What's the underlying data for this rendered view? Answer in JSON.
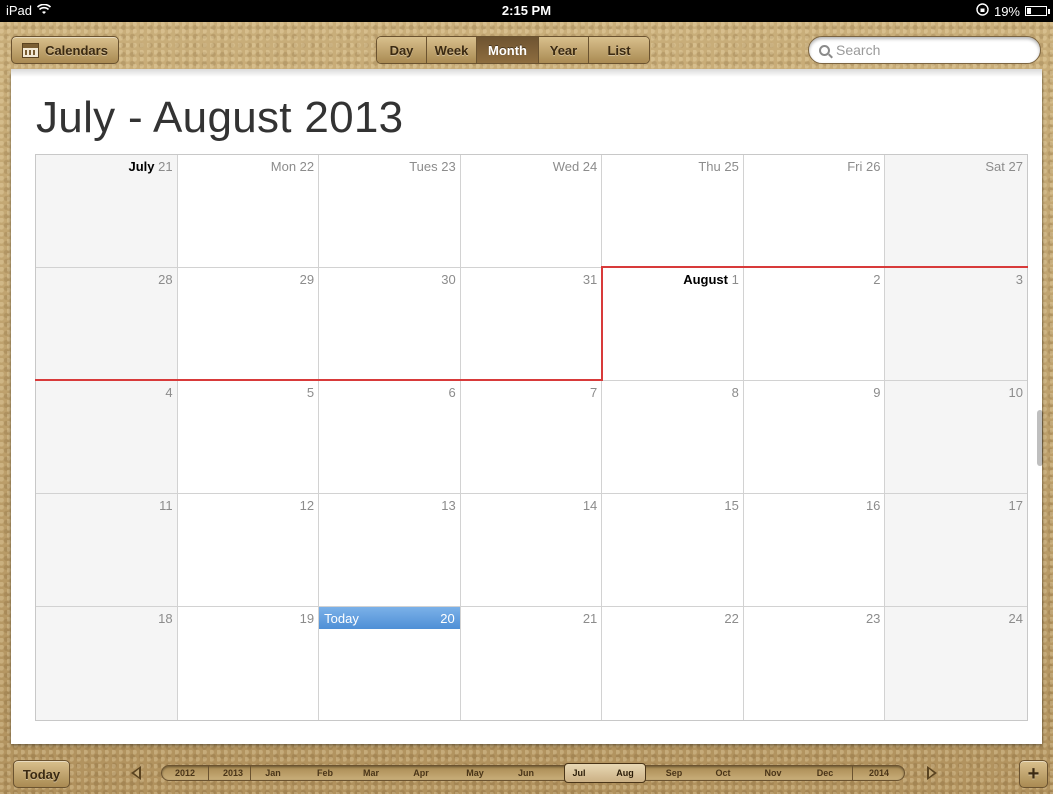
{
  "statusbar": {
    "device": "iPad",
    "time": "2:15 PM",
    "battery": "19%"
  },
  "toolbar": {
    "calendars_label": "Calendars",
    "views": [
      {
        "label": "Day",
        "active": false
      },
      {
        "label": "Week",
        "active": false
      },
      {
        "label": "Month",
        "active": true
      },
      {
        "label": "Year",
        "active": false
      },
      {
        "label": "List",
        "active": false
      }
    ],
    "search_placeholder": "Search"
  },
  "main": {
    "title": "July - August 2013",
    "weeks": [
      [
        {
          "bold": "July",
          "label": " 21"
        },
        {
          "label": "Mon 22"
        },
        {
          "label": "Tues 23"
        },
        {
          "label": "Wed 24"
        },
        {
          "label": "Thu 25"
        },
        {
          "label": "Fri 26"
        },
        {
          "label": "Sat 27"
        }
      ],
      [
        {
          "label": "28"
        },
        {
          "label": "29"
        },
        {
          "label": "30"
        },
        {
          "label": "31"
        },
        {
          "bold": "August",
          "label": " 1"
        },
        {
          "label": "2"
        },
        {
          "label": "3"
        }
      ],
      [
        {
          "label": "4"
        },
        {
          "label": "5"
        },
        {
          "label": "6"
        },
        {
          "label": "7"
        },
        {
          "label": "8"
        },
        {
          "label": "9"
        },
        {
          "label": "10"
        }
      ],
      [
        {
          "label": "11"
        },
        {
          "label": "12"
        },
        {
          "label": "13"
        },
        {
          "label": "14"
        },
        {
          "label": "15"
        },
        {
          "label": "16"
        },
        {
          "label": "17"
        }
      ],
      [
        {
          "label": "18"
        },
        {
          "label": "19"
        },
        {
          "today": true,
          "label": "Today",
          "day": "20"
        },
        {
          "label": "21"
        },
        {
          "label": "22"
        },
        {
          "label": "23"
        },
        {
          "label": "24"
        }
      ]
    ]
  },
  "bottom": {
    "today_label": "Today",
    "add_label": "+",
    "timeline": [
      "2012",
      "2013",
      "Jan",
      "Feb",
      "Mar",
      "Apr",
      "May",
      "Jun",
      "Jul",
      "Aug",
      "Sep",
      "Oct",
      "Nov",
      "Dec",
      "2014"
    ],
    "selected": [
      "Jul",
      "Aug"
    ]
  },
  "colors": {
    "accent": "#4e8fd6",
    "month_boundary": "#d83a3a",
    "leather": "#b89c6a"
  }
}
